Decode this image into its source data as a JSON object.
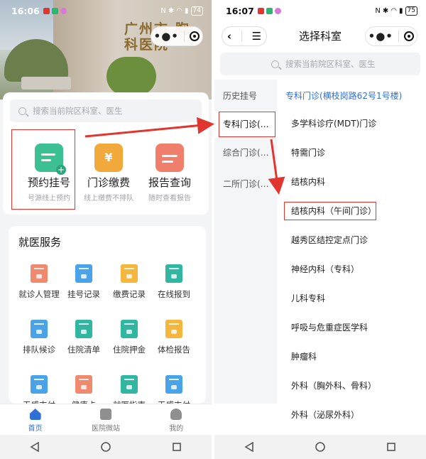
{
  "left": {
    "status_time": "16:06",
    "battery": "74",
    "hero_sign": "广州市 胸科医院",
    "search_placeholder": "搜索当前院区科室、医生",
    "services": [
      {
        "title": "预约挂号",
        "subtitle": "号源线上预约",
        "color": "#3bbf93",
        "icon": "calendar-add-icon"
      },
      {
        "title": "门诊缴费",
        "subtitle": "线上缴费不排队",
        "color": "#f2a93b",
        "icon": "yuan-payment-icon"
      },
      {
        "title": "报告查询",
        "subtitle": "随时查看报告",
        "color": "#ef7f6b",
        "icon": "report-chart-icon"
      }
    ],
    "section_title": "就医服务",
    "grid": [
      {
        "label": "就诊人管理",
        "color": "#ef8a6e"
      },
      {
        "label": "挂号记录",
        "color": "#4aa3e8"
      },
      {
        "label": "缴费记录",
        "color": "#f4b63c"
      },
      {
        "label": "在线报到",
        "color": "#31b6a1"
      },
      {
        "label": "排队候诊",
        "color": "#4aa3e8"
      },
      {
        "label": "住院清单",
        "color": "#31b6a1"
      },
      {
        "label": "住院押金",
        "color": "#31b6a1"
      },
      {
        "label": "体检报告",
        "color": "#f4b63c"
      },
      {
        "label": "无感支付",
        "color": "#4aa3e8"
      },
      {
        "label": "健康卡",
        "color": "#ef8a6e"
      },
      {
        "label": "就医指南",
        "color": "#31b6a1"
      },
      {
        "label": "无感支付",
        "color": "#4aa3e8"
      }
    ],
    "tabs": [
      {
        "label": "首页",
        "active": true
      },
      {
        "label": "医院微站",
        "active": false
      },
      {
        "label": "我的",
        "active": false
      }
    ]
  },
  "right": {
    "status_time": "16:07",
    "battery": "75",
    "page_title": "选择科室",
    "search_placeholder": "搜索当前院区科室、医生",
    "sidebar": [
      "历史挂号",
      "专科门诊(…",
      "综合门诊(…",
      "二所门诊(…"
    ],
    "active_sidebar_index": 1,
    "dept_header": "专科门诊(横枝岗路62号1号楼)",
    "departments": [
      "多学科诊疗(MDT)门诊",
      "特需门诊",
      "结核内科",
      "结核内科（午间门诊）",
      "越秀区结控定点门诊",
      "神经内科（专科）",
      "儿科专科",
      "呼吸与危重症医学科",
      "肿瘤科",
      "外科（胸外科、骨科）",
      "外科（泌尿外科）"
    ],
    "highlighted_department_index": 3
  },
  "accent_color": "#2f6fd6",
  "highlight_color": "#e0362f"
}
